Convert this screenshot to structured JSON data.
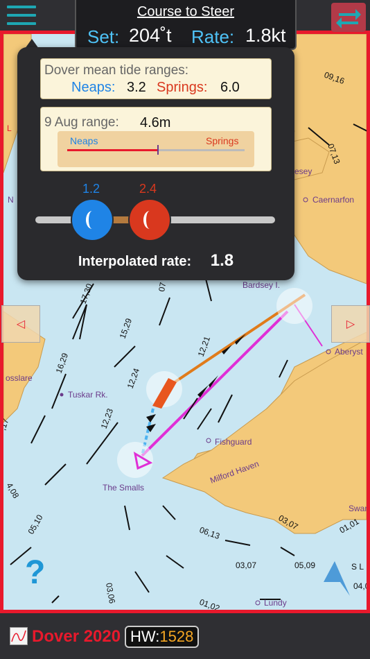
{
  "header": {
    "course_title": "Course to Steer",
    "set_label": "Set:",
    "set_value": "204˚t",
    "rate_label": "Rate:",
    "rate_value": "1.8kt"
  },
  "tide_panel": {
    "title": "Dover mean tide ranges:",
    "neaps_label": "Neaps:",
    "neaps_value": "3.2",
    "springs_label": "Springs:",
    "springs_value": "6.0",
    "range_label": "9 Aug range:",
    "range_value": "4.6m",
    "bar_neaps_label": "Neaps",
    "bar_springs_label": "Springs",
    "range_position_fraction": 0.5,
    "neaps_knob_value": "1.2",
    "springs_knob_value": "2.4",
    "interp_label": "Interpolated rate:",
    "interp_value": "1.8"
  },
  "map_labels": {
    "cardigan": "Caernarfon",
    "anglesey": "esey",
    "bardsey": "Bardsey I.",
    "aberystwyth": "Aberyst",
    "rosslare": "osslare",
    "tuskar": "Tuskar Rk.",
    "fishguard": "Fishguard",
    "milford": "Milford Haven",
    "smalls": "The Smalls",
    "swansea": "Swan",
    "lundy": "Lundy",
    "north_l": "L",
    "n_label": "N",
    "sl": "S L"
  },
  "tide_numbers": [
    "09,16",
    "07,13",
    "17,30",
    "15,29",
    "16,29",
    "12,21",
    "12,24",
    "12,23",
    "4,08",
    "05,10",
    "06,13",
    "03,07",
    "01,01",
    "03,07",
    "05,09",
    "04,0",
    "03,06",
    "01,02",
    "07",
    ",17"
  ],
  "bottom": {
    "port_name": "Dover 2020",
    "hw_label": "HW:",
    "hw_value": "1528"
  },
  "colors": {
    "neaps": "#1f84e6",
    "springs": "#d9381e",
    "course_orange": "#e07b1a",
    "course_magenta": "#e02fd6",
    "border_red": "#e8192c",
    "land": "#f3c97a",
    "sea": "#c9e6f2"
  }
}
